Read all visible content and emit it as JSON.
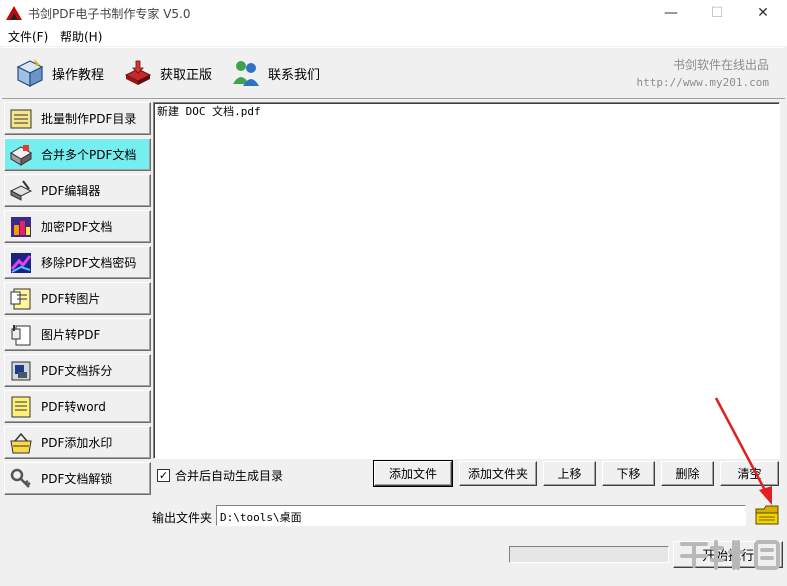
{
  "window": {
    "title": "书剑PDF电子书制作专家 V5.0",
    "minimize": "—",
    "maximize": "☐",
    "close": "✕"
  },
  "menu": [
    {
      "label": "文件(F)"
    },
    {
      "label": "帮助(H)"
    }
  ],
  "toolbar": {
    "buttons": [
      {
        "label": "操作教程",
        "icon": "tutorial-icon"
      },
      {
        "label": "获取正版",
        "icon": "purchase-icon"
      },
      {
        "label": "联系我们",
        "icon": "contact-icon"
      }
    ],
    "brand_name": "书剑软件在线出品",
    "brand_url": "http://www.my201.com"
  },
  "sidebar": {
    "items": [
      {
        "label": "批量制作PDF目录",
        "icon": "document-list-icon",
        "active": false
      },
      {
        "label": "合并多个PDF文档",
        "icon": "merge-icon",
        "active": true
      },
      {
        "label": "PDF编辑器",
        "icon": "editor-icon",
        "active": false
      },
      {
        "label": "加密PDF文档",
        "icon": "encrypt-icon",
        "active": false
      },
      {
        "label": "移除PDF文档密码",
        "icon": "remove-password-icon",
        "active": false
      },
      {
        "label": "PDF转图片",
        "icon": "pdf-to-image-icon",
        "active": false
      },
      {
        "label": "图片转PDF",
        "icon": "image-to-pdf-icon",
        "active": false
      },
      {
        "label": "PDF文档拆分",
        "icon": "split-icon",
        "active": false
      },
      {
        "label": "PDF转word",
        "icon": "pdf-to-word-icon",
        "active": false
      },
      {
        "label": "PDF添加水印",
        "icon": "watermark-icon",
        "active": false
      },
      {
        "label": "PDF文档解锁",
        "icon": "unlock-icon",
        "active": false
      }
    ]
  },
  "file_list": [
    "新建 DOC 文档.pdf"
  ],
  "options": {
    "auto_toc_label": "合并后自动生成目录",
    "auto_toc_checked": true
  },
  "actions": {
    "add_file": "添加文件",
    "add_folder": "添加文件夹",
    "move_up": "上移",
    "move_down": "下移",
    "delete": "删除",
    "clear": "清空"
  },
  "output": {
    "label": "输出文件夹",
    "path": "D:\\tools\\桌面"
  },
  "progress": {
    "value": 0
  },
  "start_label": "开始执行",
  "colors": {
    "active_sidebar": "#75eef0",
    "annotation_arrow": "#e02020"
  }
}
